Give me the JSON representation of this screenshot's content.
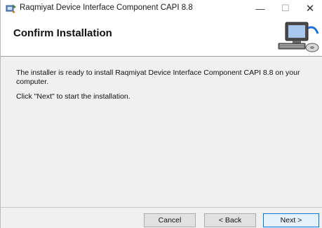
{
  "window": {
    "title": "Raqmiyat Device Interface Component CAPI 8.8",
    "controls": {
      "minimize": "—",
      "maximize": "☐",
      "close": "✕"
    }
  },
  "header": {
    "title": "Confirm Installation",
    "graphic": "computer-installer-graphic"
  },
  "body": {
    "message": "The installer is ready to install Raqmiyat Device Interface Component CAPI 8.8 on your computer.",
    "instruction": "Click \"Next\" to start the installation."
  },
  "buttons": {
    "cancel": "Cancel",
    "back": "< Back",
    "next": "Next >"
  },
  "colors": {
    "dialog_bg": "#f0f0f0",
    "header_bg": "#ffffff",
    "default_button_border": "#0078d7"
  }
}
